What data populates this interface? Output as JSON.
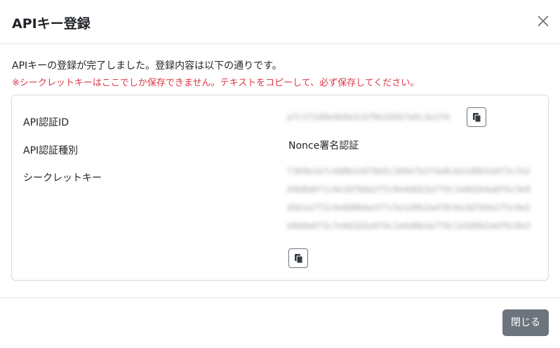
{
  "modal": {
    "title": "APIキー登録",
    "message": "APIキーの登録が完了しました。登録内容は以下の通りです。",
    "warning": "※シークレットキーはここでしか保存できません。テキストをコピーして、必ず保存してください。",
    "fields": {
      "api_id_label": "API認証ID",
      "api_id_value": "a7c1f2d9e4b8a3c6f0e2d5b7a9c3e1f4",
      "auth_type_label": "API認証種別",
      "auth_type_value": "Nonce署名認証",
      "secret_label": "シークレットキー",
      "secret_value": "f3b9e2a7c4d8b1e6f0a5c3d9e7b2f4a8c6e1d0b5a9f3c7e2d4b8a6f1c9e3d7b0a2f5c8e4d6b3a7f9c1e0d2b4a8f6c3e9d5b1a7f2c4e8d0b6a3f7c5e1d9b2a4f8c6e3d7b0a1f5c9e2d4b8a6f3c7e0d1b5a9f4c2e6d8b3a7f0c1e5d9b2a4f6c8e3"
    },
    "close_button_label": "閉じる"
  },
  "icons": {
    "close": "close-icon",
    "copy": "copy-icon"
  },
  "colors": {
    "warning": "#dc3545",
    "button_gray": "#6c757d"
  }
}
